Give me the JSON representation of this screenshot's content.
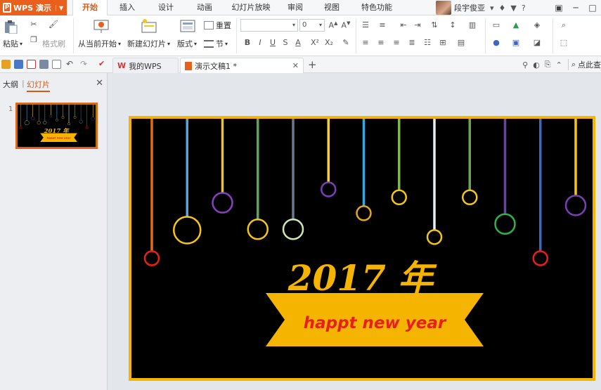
{
  "titlebar": {
    "app_name": "WPS 演示",
    "tabs": [
      "开始",
      "插入",
      "设计",
      "动画",
      "幻灯片放映",
      "审阅",
      "视图",
      "特色功能"
    ],
    "user_name": "段宇俊亚"
  },
  "ribbon": {
    "paste": "粘贴",
    "format_painter": "格式刷",
    "from_current": "从当前开始",
    "new_slide": "新建幻灯片",
    "layout": "版式",
    "reset": "重置",
    "section": "节",
    "font_size": "0"
  },
  "quickbar": {
    "tabs": [
      {
        "label": "我的WPS"
      },
      {
        "label": "演示文稿1 *"
      }
    ],
    "search_label": "点此查"
  },
  "panel": {
    "tab_outline": "大纲",
    "tab_slides": "幻灯片",
    "slide_number": "1"
  },
  "slide": {
    "year_text": "2017 年",
    "banner_text": "happt new year",
    "colors": {
      "background": "#000000",
      "border": "#f5b400",
      "year": "#f5b400",
      "banner": "#f5b400",
      "banner_text": "#e8201a"
    },
    "pendants": [
      {
        "color": "#e26a1f",
        "ring": "#e8201a",
        "length": 0.5,
        "radius": "small"
      },
      {
        "color": "#5aa2e0",
        "ring": "#f5c518",
        "length": 0.37,
        "radius": "large"
      },
      {
        "color": "#e8c23c",
        "ring": "#8a3fc0",
        "length": 0.28,
        "radius": "medium"
      },
      {
        "color": "#5fa35c",
        "ring": "#f5c518",
        "length": 0.38,
        "radius": "medium"
      },
      {
        "color": "#6b7a8f",
        "ring": "#cfe8b0",
        "length": 0.38,
        "radius": "medium"
      },
      {
        "color": "#f2d03a",
        "ring": "#7a3fb8",
        "length": 0.24,
        "radius": "small"
      },
      {
        "color": "#3aa7e0",
        "ring": "#e0a820",
        "length": 0.33,
        "radius": "small"
      },
      {
        "color": "#7fb552",
        "ring": "#f5c518",
        "length": 0.27,
        "radius": "small"
      },
      {
        "color": "#e7eef5",
        "ring": "#f5c518",
        "length": 0.42,
        "radius": "small"
      },
      {
        "color": "#6aa35a",
        "ring": "#f5c518",
        "length": 0.27,
        "radius": "small"
      },
      {
        "color": "#6a3fb0",
        "ring": "#2db34a",
        "length": 0.36,
        "radius": "medium"
      },
      {
        "color": "#3a66c4",
        "ring": "#e8201a",
        "length": 0.5,
        "radius": "small"
      },
      {
        "color": "#f5c518",
        "ring": "#7a3fb8",
        "length": 0.29,
        "radius": "medium"
      }
    ]
  }
}
